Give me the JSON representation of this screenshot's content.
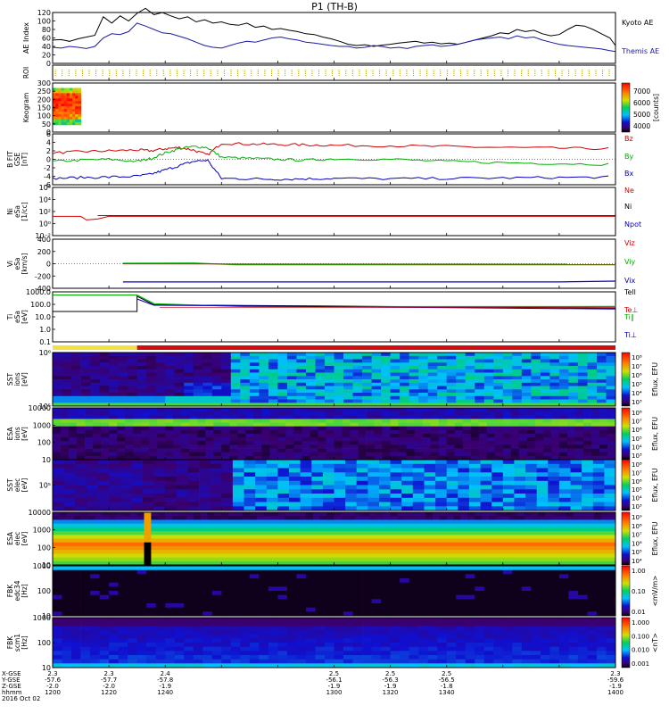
{
  "title": "P1  (TH-B)",
  "chart_data": [
    {
      "type": "line",
      "panel": "ae_index",
      "ylabel": "AE Index",
      "ylim": [
        0,
        120
      ],
      "yticks": [
        "120",
        "100",
        "80",
        "60",
        "40",
        "20",
        "0"
      ],
      "series": [
        {
          "name": "Kyoto AE",
          "color": "#000000",
          "x": [
            1200,
            1203,
            1206,
            1209,
            1212,
            1215,
            1218,
            1221,
            1224,
            1227,
            1230,
            1233,
            1236,
            1239,
            1242,
            1245,
            1248,
            1251,
            1254,
            1257,
            1260,
            1263,
            1266,
            1269,
            1272,
            1275,
            1278,
            1281,
            1284,
            1287,
            1290,
            1293,
            1296,
            1299,
            1302,
            1305,
            1308,
            1311,
            1314,
            1317,
            1320,
            1323,
            1326,
            1329,
            1332,
            1335,
            1338,
            1341,
            1344,
            1347,
            1350,
            1353,
            1356,
            1359,
            1362,
            1365,
            1368,
            1371,
            1374,
            1377,
            1380,
            1383,
            1386,
            1389,
            1392,
            1395,
            1398,
            1400
          ],
          "y": [
            55,
            56,
            52,
            58,
            62,
            66,
            110,
            95,
            112,
            100,
            118,
            130,
            115,
            120,
            112,
            105,
            110,
            98,
            103,
            95,
            98,
            92,
            90,
            95,
            85,
            88,
            80,
            82,
            78,
            75,
            70,
            68,
            62,
            58,
            52,
            45,
            42,
            44,
            40,
            43,
            45,
            48,
            50,
            52,
            48,
            50,
            46,
            48,
            45,
            50,
            55,
            60,
            65,
            72,
            70,
            80,
            75,
            78,
            70,
            65,
            68,
            80,
            90,
            88,
            80,
            70,
            60,
            42
          ]
        },
        {
          "name": "Themis AE",
          "color": "#1a1aa8",
          "x": [
            1200,
            1203,
            1206,
            1209,
            1212,
            1215,
            1218,
            1221,
            1224,
            1227,
            1230,
            1233,
            1236,
            1239,
            1242,
            1245,
            1248,
            1251,
            1254,
            1257,
            1260,
            1263,
            1266,
            1269,
            1272,
            1275,
            1278,
            1281,
            1284,
            1287,
            1290,
            1293,
            1296,
            1299,
            1302,
            1305,
            1308,
            1311,
            1314,
            1317,
            1320,
            1323,
            1326,
            1329,
            1332,
            1335,
            1338,
            1341,
            1344,
            1347,
            1350,
            1353,
            1356,
            1359,
            1362,
            1365,
            1368,
            1371,
            1374,
            1377,
            1380,
            1383,
            1386,
            1389,
            1392,
            1395,
            1398,
            1400
          ],
          "y": [
            38,
            36,
            40,
            38,
            35,
            40,
            60,
            70,
            68,
            75,
            95,
            88,
            80,
            72,
            70,
            64,
            58,
            50,
            42,
            38,
            36,
            42,
            48,
            52,
            50,
            55,
            60,
            62,
            58,
            55,
            50,
            48,
            45,
            42,
            40,
            40,
            36,
            38,
            42,
            40,
            36,
            38,
            35,
            40,
            42,
            44,
            40,
            42,
            45,
            50,
            55,
            58,
            60,
            62,
            58,
            65,
            60,
            62,
            55,
            50,
            45,
            42,
            40,
            38,
            36,
            34,
            30,
            28
          ]
        }
      ]
    },
    {
      "type": "bar",
      "panel": "roi",
      "ylabel": "ROI"
    },
    {
      "type": "heatmap",
      "panel": "keogram",
      "ylabel": "Keogram",
      "yticks": [
        "300",
        "250",
        "200",
        "150",
        "100",
        "50",
        "0"
      ],
      "colorbar": {
        "label": "[counts]",
        "ticks": [
          "7000",
          "6000",
          "5000",
          "4000"
        ]
      },
      "data_extent_x": [
        1200,
        1210
      ]
    },
    {
      "type": "line",
      "panel": "bfield",
      "ylabel": "B FIT",
      "ylabel2": "GSE",
      "ylabel3": "[nT]",
      "ylim": [
        -6,
        6
      ],
      "yticks": [
        "6",
        "4",
        "2",
        "0",
        "-2",
        "-4",
        "-6"
      ],
      "series": [
        {
          "name": "Bz",
          "color": "#d00000",
          "x": [
            1200,
            1210,
            1220,
            1230,
            1235,
            1240,
            1245,
            1250,
            1255,
            1260,
            1270,
            1280,
            1290,
            1300,
            1320,
            1340,
            1360,
            1380,
            1400
          ],
          "y": [
            1.5,
            1.8,
            2.0,
            2.2,
            2.0,
            2.5,
            2.8,
            2.2,
            1.0,
            3.8,
            3.6,
            3.5,
            3.4,
            3.3,
            3.2,
            3.0,
            2.8,
            2.6,
            2.5
          ]
        },
        {
          "name": "By",
          "color": "#00b000",
          "x": [
            1200,
            1210,
            1220,
            1230,
            1235,
            1240,
            1245,
            1250,
            1255,
            1260,
            1270,
            1280,
            1290,
            1300,
            1320,
            1340,
            1360,
            1380,
            1400
          ],
          "y": [
            -0.5,
            -0.2,
            0.0,
            -0.5,
            0.2,
            1.5,
            2.5,
            3.0,
            2.8,
            0.5,
            0.2,
            0.0,
            -0.2,
            0.1,
            0.0,
            -0.5,
            -0.8,
            -1.0,
            -1.2
          ]
        },
        {
          "name": "Bx",
          "color": "#0000c0",
          "x": [
            1200,
            1210,
            1220,
            1230,
            1235,
            1240,
            1245,
            1250,
            1255,
            1260,
            1270,
            1280,
            1290,
            1300,
            1320,
            1340,
            1360,
            1380,
            1400
          ],
          "y": [
            -4.5,
            -4.3,
            -4.2,
            -4.0,
            -3.5,
            -2.5,
            -1.5,
            -0.5,
            -0.2,
            -4.5,
            -4.6,
            -4.7,
            -4.6,
            -4.5,
            -4.6,
            -4.5,
            -4.4,
            -4.3,
            -4.2
          ]
        }
      ]
    },
    {
      "type": "line",
      "panel": "density",
      "ylabel": "Ni",
      "ylabel2": "eSa",
      "ylabel3": "[1/cc]",
      "yscale": "log",
      "ylim": [
        0.001,
        1000000
      ],
      "yticks": [
        "10⁶",
        "10⁴",
        "10²",
        "10⁰",
        "10⁻²"
      ],
      "series": [
        {
          "name": "Ne",
          "color": "#d00000"
        },
        {
          "name": "Ni",
          "color": "#000000"
        },
        {
          "name": "Npot",
          "color": "#0000c0"
        }
      ]
    },
    {
      "type": "line",
      "panel": "velocity",
      "ylabel": "Vi",
      "ylabel2": "eSa",
      "ylabel3": "[km/s]",
      "ylim": [
        -500,
        500
      ],
      "yticks": [
        "400",
        "200",
        "0",
        "-200",
        "-400"
      ],
      "series": [
        {
          "name": "Viz",
          "color": "#d00000"
        },
        {
          "name": "Viy",
          "color": "#00b000"
        },
        {
          "name": "Vix",
          "color": "#0000c0"
        }
      ]
    },
    {
      "type": "line",
      "panel": "temperature",
      "ylabel": "Ti",
      "ylabel2": "eSa",
      "ylabel3": "[eV]",
      "yscale": "log",
      "yticks": [
        "1000.0",
        "100.0",
        "10.0",
        "1.0",
        "0.1"
      ],
      "series": [
        {
          "name": "Tell",
          "color": "#000000"
        },
        {
          "name": "Te⊥",
          "color": "#d00000"
        },
        {
          "name": "Ti∥",
          "color": "#00b000"
        },
        {
          "name": "Ti⊥",
          "color": "#0000c0"
        }
      ]
    },
    {
      "type": "heatmap",
      "panel": "sst_ion",
      "ylabel": "SST",
      "ylabel2": "ions",
      "ylabel3": "[eV]",
      "yticks": [
        "10⁶",
        "10⁵"
      ],
      "colorbar": {
        "label": "Eflux, EFU",
        "ticks": [
          "10⁸",
          "10⁷",
          "10⁶",
          "10⁵",
          "10⁴",
          "10³"
        ]
      }
    },
    {
      "type": "heatmap",
      "panel": "esa_ion",
      "ylabel": "ESA",
      "ylabel2": "ions",
      "ylabel3": "[eV]",
      "yticks": [
        "10000",
        "1000",
        "100",
        "10"
      ],
      "colorbar": {
        "label": "Eflux, EFU",
        "ticks": [
          "10⁸",
          "10⁷",
          "10⁶",
          "10⁵",
          "10⁴",
          "10³"
        ]
      }
    },
    {
      "type": "heatmap",
      "panel": "sst_elec",
      "ylabel": "SST",
      "ylabel2": "elec",
      "ylabel3": "[eV]",
      "yticks": [
        "10⁵"
      ],
      "colorbar": {
        "label": "Eflux, EFU",
        "ticks": [
          "10⁸",
          "10⁷",
          "10⁶",
          "10⁵",
          "10⁴",
          "10³"
        ]
      }
    },
    {
      "type": "heatmap",
      "panel": "esa_elec",
      "ylabel": "ESA",
      "ylabel2": "elec",
      "ylabel3": "[eV]",
      "yticks": [
        "10000",
        "1000",
        "100",
        "10"
      ],
      "colorbar": {
        "label": "Eflux, EFU",
        "ticks": [
          "10⁹",
          "10⁸",
          "10⁷",
          "10⁶",
          "10⁵",
          "10⁴"
        ]
      }
    },
    {
      "type": "heatmap",
      "panel": "fbk_e",
      "ylabel": "FBK",
      "ylabel2": "edc34",
      "ylabel3": "[Hz]",
      "yticks": [
        "1000",
        "100",
        "10"
      ],
      "colorbar": {
        "label": "<mV/m>",
        "ticks": [
          "1.00",
          "0.10",
          "0.01"
        ]
      }
    },
    {
      "type": "heatmap",
      "panel": "fbk_b",
      "ylabel": "FBK",
      "ylabel2": "scm1",
      "ylabel3": "[Hz]",
      "yticks": [
        "1000",
        "100",
        "10"
      ],
      "colorbar": {
        "label": "<nT>",
        "ticks": [
          "1.000",
          "0.100",
          "0.010",
          "0.001"
        ]
      }
    }
  ],
  "xaxis": {
    "xlim": [
      1200,
      1400
    ],
    "row_labels": [
      "X-GSE",
      "Y-GSE",
      "Z-GSE",
      "hhmm",
      "2016 Oct 02"
    ],
    "columns": [
      {
        "x": 1200,
        "vals": [
          "2.3",
          "-57.6",
          "-2.0",
          "1200"
        ]
      },
      {
        "x": 1220,
        "vals": [
          "2.3",
          "-57.7",
          "-2.0",
          "1220"
        ]
      },
      {
        "x": 1240,
        "vals": [
          "2.4",
          "-57.8",
          "-1.9",
          "1240"
        ]
      },
      {
        "x": 1300,
        "vals": [
          "2.5",
          "-56.1",
          "-1.9",
          "1300"
        ]
      },
      {
        "x": 1320,
        "vals": [
          "2.5",
          "-56.3",
          "-1.9",
          "1320"
        ]
      },
      {
        "x": 1340,
        "vals": [
          "2.5",
          "-56.5",
          "-1.8",
          "1340"
        ]
      },
      {
        "x": 1400,
        "vals": [
          "2.3",
          "-59.6",
          "-1.9",
          "1400"
        ]
      }
    ]
  },
  "mode_bar": [
    {
      "from": 1200,
      "to": 1230,
      "color": "#f0e040"
    },
    {
      "from": 1230,
      "to": 1400,
      "color": "#d01010"
    }
  ]
}
